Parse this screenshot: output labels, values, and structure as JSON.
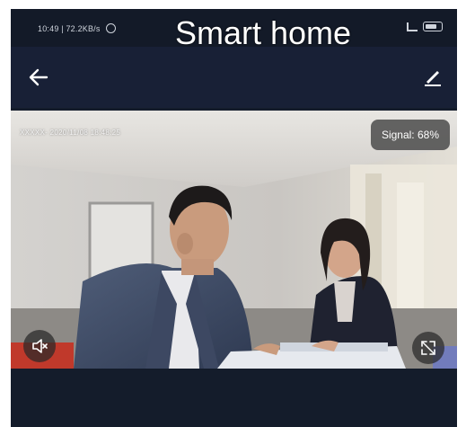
{
  "status_bar": {
    "left_text": "10:49 | 72.2KB/s",
    "right_text": ""
  },
  "app_title": "Smart home",
  "video": {
    "timestamp": "XXXXX- 2020/11/08 18:48:25",
    "signal": "Signal: 68%"
  },
  "icons": {
    "back": "arrow-left-icon",
    "edit": "pencil-icon",
    "mute": "speaker-mute-icon",
    "fullscreen": "fullscreen-icon",
    "alarm": "alarm-clock-icon",
    "battery": "battery-icon"
  },
  "colors": {
    "status_bar": "#131a28",
    "nav_bar": "#182036",
    "bottom_panel": "#141c2b",
    "signal_badge": "#464646"
  }
}
